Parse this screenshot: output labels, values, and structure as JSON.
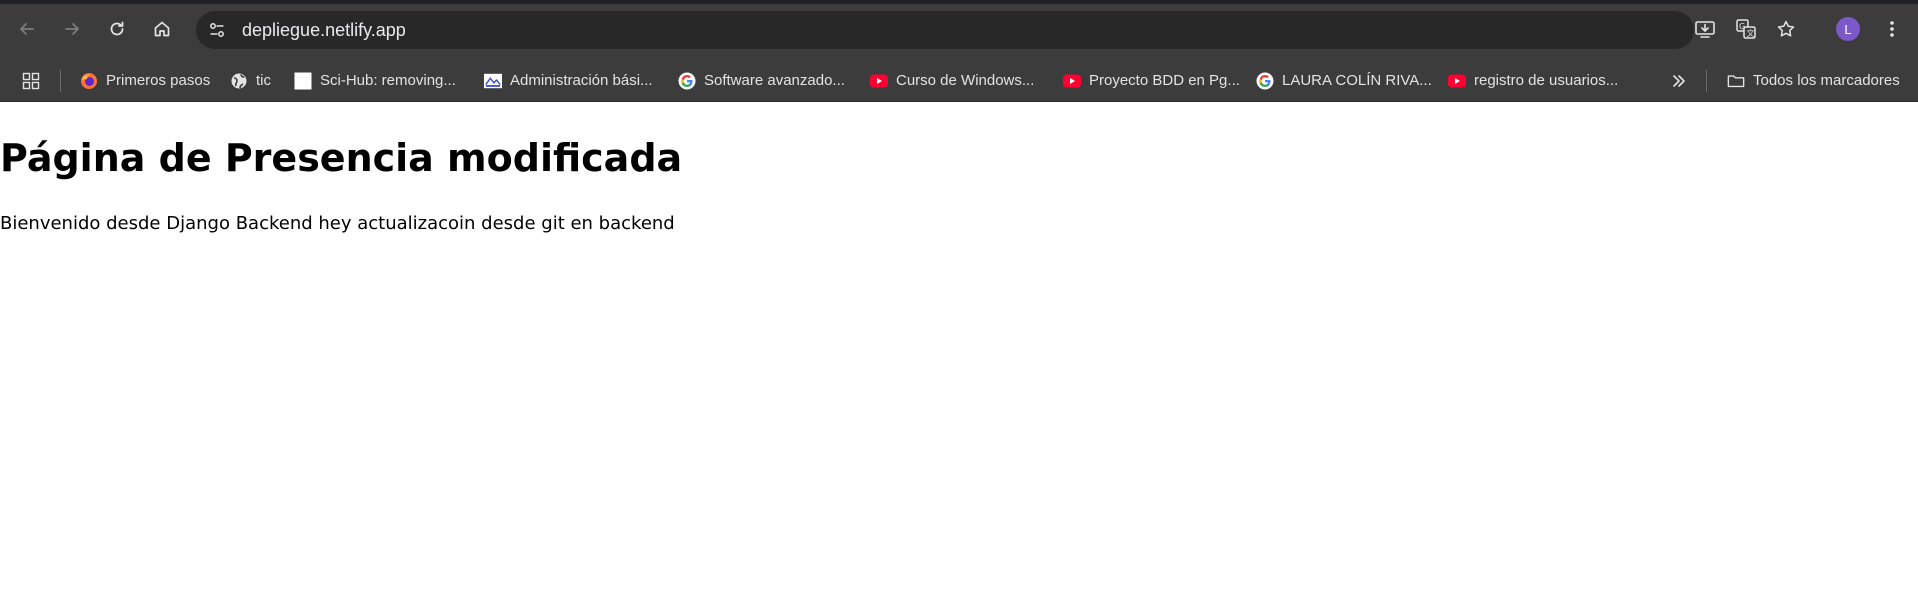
{
  "browser": {
    "url": "depliegue.netlify.app",
    "profile_initial": "L",
    "icons": {
      "back": "arrow-left-icon",
      "forward": "arrow-right-icon",
      "reload": "reload-icon",
      "home": "home-icon",
      "site_info": "tune-icon",
      "install": "install-app-icon",
      "translate": "translate-icon",
      "bookmark": "star-icon",
      "menu": "kebab-menu-icon"
    },
    "colors": {
      "toolbar": "#3c3c3c",
      "omnibox": "#282828",
      "avatar": "#7b59c8"
    }
  },
  "bookmarks_bar": {
    "apps_icon": "apps-grid-icon",
    "items": [
      {
        "label": "Primeros pasos",
        "icon": "firefox-icon"
      },
      {
        "label": "tic",
        "icon": "globe-icon"
      },
      {
        "label": "Sci-Hub: removing...",
        "icon": "blank-page-icon"
      },
      {
        "label": "Administración bási...",
        "icon": "site-favicon-icon"
      },
      {
        "label": "Software avanzado...",
        "icon": "google-icon"
      },
      {
        "label": "Curso de Windows...",
        "icon": "youtube-icon"
      },
      {
        "label": "Proyecto BDD en Pg...",
        "icon": "youtube-icon"
      },
      {
        "label": "LAURA COLÍN RIVA...",
        "icon": "google-icon"
      },
      {
        "label": "registro de usuarios...",
        "icon": "youtube-icon"
      }
    ],
    "more_icon": "chevron-double-right-icon",
    "all_bookmarks": {
      "label": "Todos los marcadores",
      "icon": "folder-icon"
    }
  },
  "page": {
    "heading": "Página de Presencia modificada",
    "paragraph": "Bienvenido desde Django Backend hey actualizacoin desde git en backend"
  }
}
